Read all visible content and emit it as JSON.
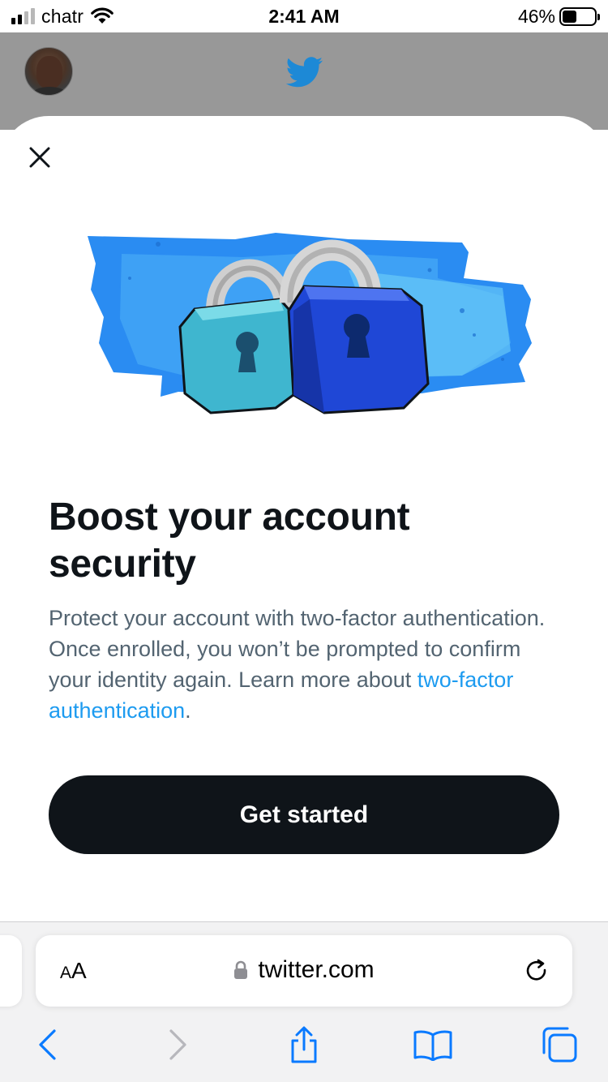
{
  "status_bar": {
    "carrier": "chatr",
    "time": "2:41 AM",
    "battery_percent": "46%",
    "battery_level": 0.46,
    "signal_bars_active": 2,
    "signal_bars_total": 4
  },
  "header": {
    "avatar_icon": "user-avatar",
    "logo_icon": "twitter-bird-icon",
    "brand_color": "#1d9bf0"
  },
  "modal": {
    "close_icon": "close-icon",
    "hero_illustration": "padlocks-illustration",
    "title": "Boost your account security",
    "description_text": "Protect your account with two-factor authentication. Once enrolled, you won’t be prompted to confirm your identity again. Learn more about ",
    "description_link": "two-factor authentication",
    "description_end": ".",
    "cta_label": "Get started",
    "cta_color": "#0f1419",
    "link_color": "#1d9bf0"
  },
  "browser": {
    "text_size_big": "A",
    "text_size_small": "A",
    "url": "twitter.com",
    "lock_icon": "lock-icon",
    "reload_icon": "reload-icon",
    "toolbar": [
      "back-icon",
      "forward-icon",
      "share-icon",
      "bookmarks-icon",
      "tabs-icon"
    ],
    "accent_color": "#0a7aff"
  }
}
